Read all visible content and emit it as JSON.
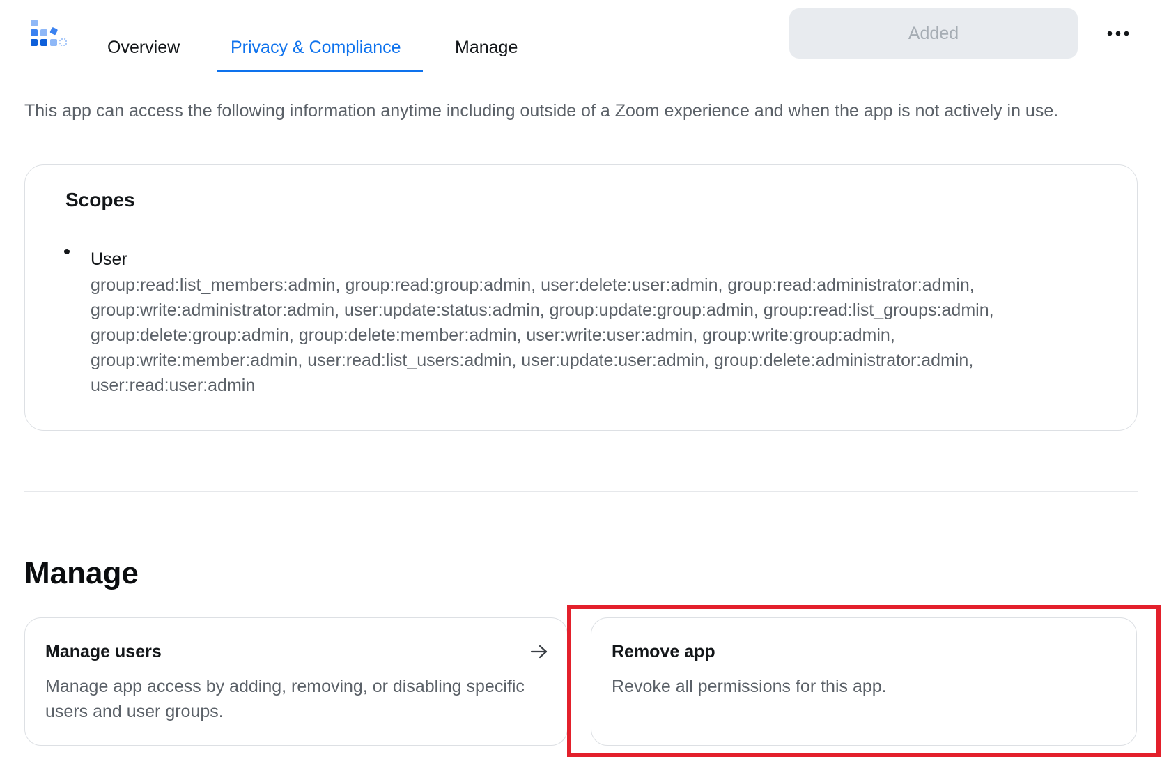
{
  "header": {
    "tabs": [
      {
        "label": "Overview",
        "active": false
      },
      {
        "label": "Privacy & Compliance",
        "active": true
      },
      {
        "label": "Manage",
        "active": false
      }
    ],
    "added_label": "Added",
    "more_icon": "more-horizontal-icon",
    "logo_icon": "app-logo-icon"
  },
  "intro": "This app can access the following information anytime including outside of a Zoom experience and when the app is not actively in use.",
  "scopes": {
    "title": "Scopes",
    "items": [
      {
        "name": "User",
        "permissions": "group:read:list_members:admin, group:read:group:admin, user:delete:user:admin, group:read:administrator:admin, group:write:administrator:admin, user:update:status:admin, group:update:group:admin, group:read:list_groups:admin, group:delete:group:admin, group:delete:member:admin, user:write:user:admin, group:write:group:admin, group:write:member:admin, user:read:list_users:admin, user:update:user:admin, group:delete:administrator:admin, user:read:user:admin"
      }
    ]
  },
  "manage": {
    "heading": "Manage",
    "cards": [
      {
        "title": "Manage users",
        "description": "Manage app access by adding, removing, or disabling specific users and user groups.",
        "icon": "arrow-right-icon"
      },
      {
        "title": "Remove app",
        "description": "Revoke all permissions for this app."
      }
    ]
  },
  "colors": {
    "accent": "#0e72ed",
    "highlight": "#e3202b",
    "muted_text": "#5b6168",
    "disabled_button": "#e8ebef"
  }
}
